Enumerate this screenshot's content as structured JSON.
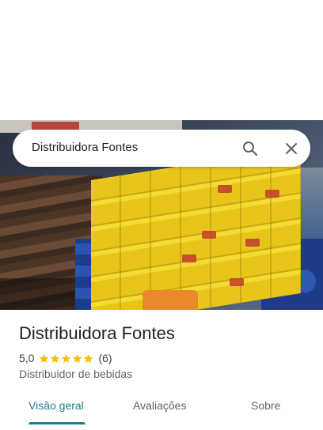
{
  "search": {
    "query": "Distribuidora Fontes",
    "search_icon": "search-icon",
    "close_icon": "close-icon"
  },
  "place": {
    "name": "Distribuidora Fontes",
    "rating": "5,0",
    "stars": 5,
    "review_count": "(6)",
    "category": "Distribuidor de bebidas"
  },
  "tabs": [
    {
      "label": "Visão geral",
      "active": true
    },
    {
      "label": "Avaliações",
      "active": false
    },
    {
      "label": "Sobre",
      "active": false
    }
  ],
  "colors": {
    "accent": "#1a7f8e",
    "star": "#fbbc04"
  }
}
